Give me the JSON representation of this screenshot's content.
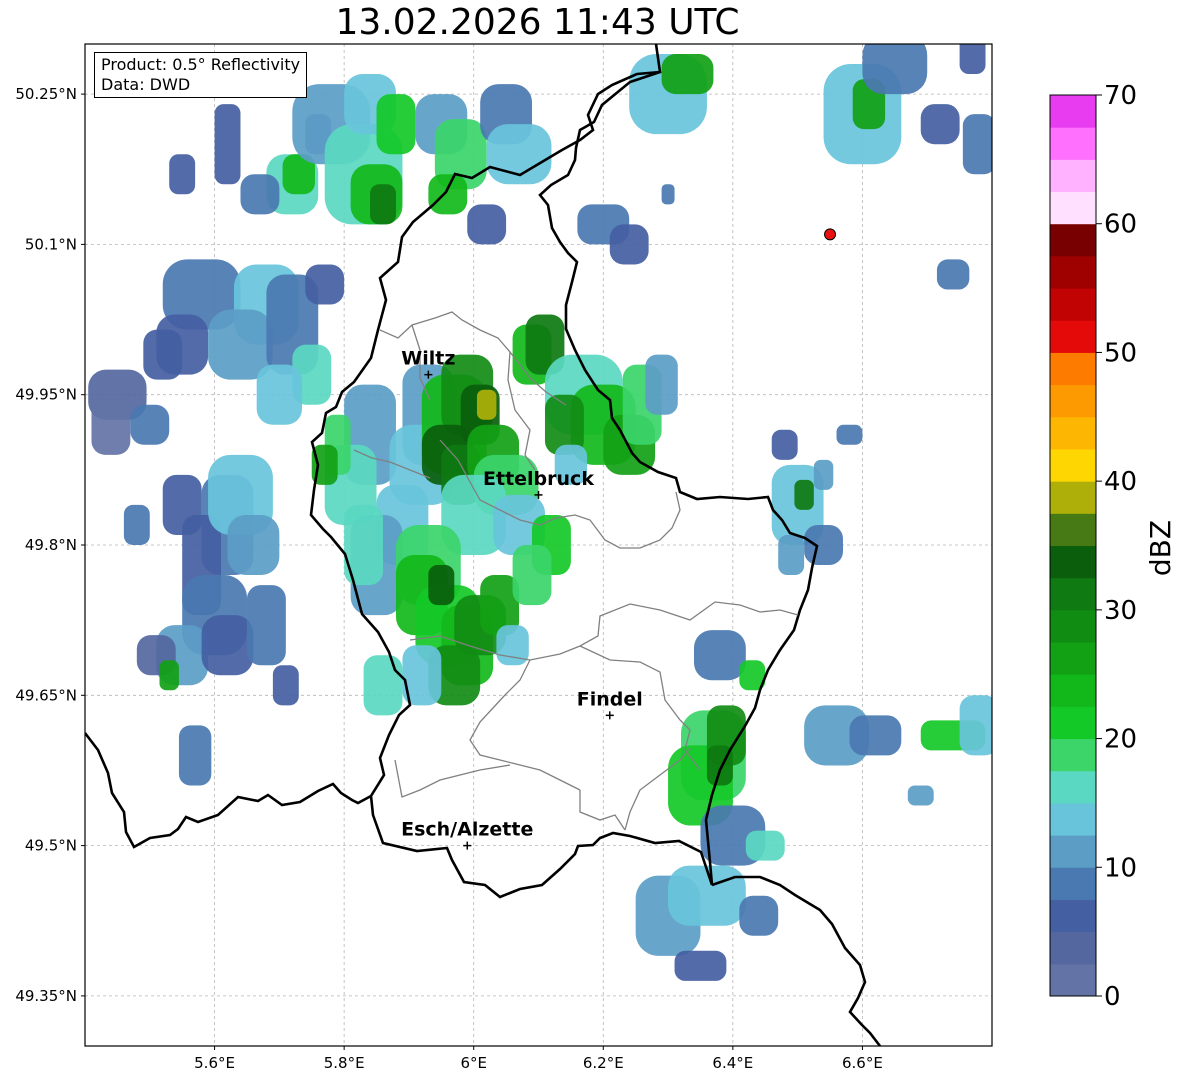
{
  "header": {
    "title": "13.02.2026 11:43 UTC"
  },
  "info_box": {
    "product": "Product: 0.5° Reflectivity",
    "data": "Data: DWD"
  },
  "axes": {
    "lon_range": [
      5.4,
      6.8
    ],
    "lat_range": [
      49.3,
      50.3
    ],
    "x_ticks": [
      "5.6°E",
      "5.8°E",
      "6°E",
      "6.2°E",
      "6.4°E",
      "6.6°E"
    ],
    "x_tick_values": [
      5.6,
      5.8,
      6.0,
      6.2,
      6.4,
      6.6
    ],
    "y_ticks": [
      "50.25°N",
      "50.1°N",
      "49.95°N",
      "49.8°N",
      "49.65°N",
      "49.5°N",
      "49.35°N"
    ],
    "y_tick_values": [
      50.25,
      50.1,
      49.95,
      49.8,
      49.65,
      49.5,
      49.35
    ],
    "grid": true
  },
  "cities": [
    {
      "name": "Wiltz",
      "lon": 5.93,
      "lat": 49.97
    },
    {
      "name": "Ettelbruck",
      "lon": 6.1,
      "lat": 49.85
    },
    {
      "name": "Findel",
      "lon": 6.21,
      "lat": 49.63
    },
    {
      "name": "Esch/Alzette",
      "lon": 5.99,
      "lat": 49.5
    }
  ],
  "radar_site": {
    "lon": 6.55,
    "lat": 50.11,
    "color": "#e81010"
  },
  "colorbar": {
    "label": "dBZ",
    "min": 0,
    "max": 70,
    "tick_labels": [
      "0",
      "10",
      "20",
      "30",
      "40",
      "50",
      "60",
      "70"
    ],
    "tick_values": [
      0,
      10,
      20,
      30,
      40,
      50,
      60,
      70
    ],
    "colors": [
      "#6373a5",
      "#54679f",
      "#4460a2",
      "#4a78b1",
      "#5b9dc5",
      "#68c4db",
      "#5ad8c1",
      "#3bd56a",
      "#13c927",
      "#12b81a",
      "#12a115",
      "#118c13",
      "#0e7a11",
      "#0a5e0c",
      "#477a14",
      "#aeb009",
      "#fed702",
      "#fdb702",
      "#fd9a01",
      "#fd7c00",
      "#e40a0a",
      "#c20303",
      "#9f0101",
      "#790000",
      "#ffe0ff",
      "#ffb2ff",
      "#ff70ff",
      "#e73cf0"
    ]
  },
  "echoes": [
    [
      5.45,
      49.95,
      0.045,
      0.025,
      1
    ],
    [
      5.44,
      49.92,
      0.03,
      0.03,
      0
    ],
    [
      5.52,
      49.99,
      0.03,
      0.025,
      2
    ],
    [
      5.58,
      50.05,
      0.06,
      0.035,
      3
    ],
    [
      5.55,
      50.0,
      0.04,
      0.03,
      2
    ],
    [
      5.68,
      50.04,
      0.05,
      0.04,
      5
    ],
    [
      5.64,
      50.0,
      0.05,
      0.035,
      4
    ],
    [
      5.72,
      50.02,
      0.04,
      0.05,
      3
    ],
    [
      5.75,
      49.97,
      0.03,
      0.03,
      6
    ],
    [
      5.7,
      49.95,
      0.035,
      0.03,
      5
    ],
    [
      5.77,
      50.06,
      0.03,
      0.02,
      2
    ],
    [
      5.5,
      49.92,
      0.03,
      0.02,
      3
    ],
    [
      5.72,
      50.16,
      0.04,
      0.03,
      6
    ],
    [
      5.73,
      50.17,
      0.025,
      0.02,
      9
    ],
    [
      5.67,
      50.15,
      0.03,
      0.02,
      3
    ],
    [
      5.62,
      50.2,
      0.02,
      0.04,
      2
    ],
    [
      5.76,
      50.21,
      0.02,
      0.02,
      3
    ],
    [
      5.55,
      50.17,
      0.02,
      0.02,
      2
    ],
    [
      5.78,
      50.22,
      0.06,
      0.04,
      4
    ],
    [
      5.83,
      50.17,
      0.06,
      0.05,
      6
    ],
    [
      5.85,
      50.15,
      0.04,
      0.03,
      9
    ],
    [
      5.86,
      50.14,
      0.02,
      0.02,
      12
    ],
    [
      5.84,
      50.24,
      0.04,
      0.03,
      5
    ],
    [
      5.95,
      50.22,
      0.04,
      0.03,
      4
    ],
    [
      5.98,
      50.19,
      0.04,
      0.035,
      7
    ],
    [
      5.96,
      50.15,
      0.03,
      0.02,
      9
    ],
    [
      6.05,
      50.23,
      0.04,
      0.03,
      3
    ],
    [
      6.07,
      50.19,
      0.05,
      0.03,
      5
    ],
    [
      6.02,
      50.12,
      0.03,
      0.02,
      2
    ],
    [
      6.2,
      50.12,
      0.04,
      0.02,
      3
    ],
    [
      5.88,
      50.22,
      0.03,
      0.03,
      8
    ],
    [
      5.84,
      49.91,
      0.04,
      0.05,
      4
    ],
    [
      5.81,
      49.86,
      0.04,
      0.04,
      6
    ],
    [
      5.79,
      49.9,
      0.02,
      0.03,
      7
    ],
    [
      5.77,
      49.88,
      0.02,
      0.02,
      10
    ],
    [
      5.93,
      49.93,
      0.04,
      0.05,
      4
    ],
    [
      5.92,
      49.88,
      0.05,
      0.04,
      5
    ],
    [
      5.97,
      49.92,
      0.05,
      0.05,
      9
    ],
    [
      5.99,
      49.95,
      0.04,
      0.04,
      11
    ],
    [
      6.01,
      49.93,
      0.03,
      0.03,
      13
    ],
    [
      6.02,
      49.94,
      0.015,
      0.015,
      15
    ],
    [
      5.96,
      49.89,
      0.04,
      0.03,
      13
    ],
    [
      5.98,
      49.87,
      0.03,
      0.03,
      12
    ],
    [
      6.03,
      49.89,
      0.04,
      0.03,
      10
    ],
    [
      6.05,
      49.86,
      0.05,
      0.03,
      7
    ],
    [
      6.0,
      49.83,
      0.05,
      0.04,
      6
    ],
    [
      6.07,
      49.82,
      0.04,
      0.03,
      5
    ],
    [
      6.12,
      49.8,
      0.03,
      0.03,
      8
    ],
    [
      6.09,
      49.99,
      0.03,
      0.03,
      9
    ],
    [
      6.11,
      50.0,
      0.03,
      0.03,
      12
    ],
    [
      6.17,
      49.95,
      0.06,
      0.04,
      6
    ],
    [
      6.2,
      49.92,
      0.05,
      0.04,
      9
    ],
    [
      6.24,
      49.9,
      0.04,
      0.03,
      10
    ],
    [
      6.26,
      49.94,
      0.03,
      0.04,
      7
    ],
    [
      6.14,
      49.92,
      0.03,
      0.03,
      11
    ],
    [
      6.29,
      49.96,
      0.025,
      0.03,
      4
    ],
    [
      6.15,
      49.88,
      0.025,
      0.02,
      5
    ],
    [
      5.89,
      49.82,
      0.04,
      0.04,
      5
    ],
    [
      5.85,
      49.78,
      0.04,
      0.05,
      4
    ],
    [
      5.93,
      49.78,
      0.05,
      0.04,
      7
    ],
    [
      5.92,
      49.75,
      0.04,
      0.04,
      9
    ],
    [
      5.96,
      49.72,
      0.05,
      0.04,
      8
    ],
    [
      5.99,
      49.7,
      0.04,
      0.04,
      9
    ],
    [
      6.01,
      49.72,
      0.04,
      0.03,
      11
    ],
    [
      6.04,
      49.74,
      0.03,
      0.03,
      10
    ],
    [
      6.09,
      49.77,
      0.03,
      0.03,
      7
    ],
    [
      5.97,
      49.67,
      0.04,
      0.03,
      11
    ],
    [
      5.92,
      49.67,
      0.03,
      0.03,
      5
    ],
    [
      5.86,
      49.66,
      0.03,
      0.03,
      6
    ],
    [
      5.83,
      49.8,
      0.03,
      0.04,
      6
    ],
    [
      6.06,
      49.7,
      0.025,
      0.02,
      5
    ],
    [
      5.95,
      49.76,
      0.02,
      0.02,
      13
    ],
    [
      5.62,
      49.82,
      0.04,
      0.05,
      3
    ],
    [
      5.58,
      49.78,
      0.03,
      0.05,
      2
    ],
    [
      5.64,
      49.85,
      0.05,
      0.04,
      5
    ],
    [
      5.66,
      49.8,
      0.04,
      0.03,
      4
    ],
    [
      5.55,
      49.84,
      0.03,
      0.03,
      2
    ],
    [
      5.48,
      49.82,
      0.02,
      0.02,
      3
    ],
    [
      5.6,
      49.73,
      0.05,
      0.04,
      3
    ],
    [
      5.55,
      49.69,
      0.04,
      0.03,
      4
    ],
    [
      5.62,
      49.7,
      0.04,
      0.03,
      2
    ],
    [
      5.68,
      49.72,
      0.03,
      0.04,
      3
    ],
    [
      5.51,
      49.69,
      0.03,
      0.02,
      1
    ],
    [
      5.53,
      49.67,
      0.015,
      0.015,
      10
    ],
    [
      5.71,
      49.66,
      0.02,
      0.02,
      2
    ],
    [
      5.57,
      49.59,
      0.025,
      0.03,
      3
    ],
    [
      6.37,
      49.59,
      0.05,
      0.045,
      7
    ],
    [
      6.35,
      49.56,
      0.05,
      0.04,
      8
    ],
    [
      6.39,
      49.61,
      0.03,
      0.03,
      11
    ],
    [
      6.38,
      49.58,
      0.02,
      0.02,
      12
    ],
    [
      6.4,
      49.51,
      0.05,
      0.03,
      3
    ],
    [
      6.45,
      49.5,
      0.03,
      0.015,
      6
    ],
    [
      6.38,
      49.69,
      0.04,
      0.025,
      3
    ],
    [
      6.43,
      49.67,
      0.02,
      0.015,
      8
    ],
    [
      6.56,
      49.61,
      0.05,
      0.03,
      4
    ],
    [
      6.62,
      49.61,
      0.04,
      0.02,
      3
    ],
    [
      6.74,
      49.61,
      0.05,
      0.015,
      8
    ],
    [
      6.78,
      49.62,
      0.03,
      0.03,
      5
    ],
    [
      6.3,
      49.43,
      0.05,
      0.04,
      4
    ],
    [
      6.36,
      49.45,
      0.06,
      0.03,
      5
    ],
    [
      6.35,
      49.38,
      0.04,
      0.015,
      2
    ],
    [
      6.44,
      49.43,
      0.03,
      0.02,
      3
    ],
    [
      6.69,
      49.55,
      0.02,
      0.01,
      4
    ],
    [
      6.5,
      49.84,
      0.04,
      0.04,
      5
    ],
    [
      6.51,
      49.85,
      0.015,
      0.015,
      12
    ],
    [
      6.54,
      49.87,
      0.015,
      0.015,
      4
    ],
    [
      6.54,
      49.8,
      0.03,
      0.02,
      3
    ],
    [
      6.49,
      49.79,
      0.02,
      0.02,
      4
    ],
    [
      6.48,
      49.9,
      0.02,
      0.015,
      2
    ],
    [
      6.58,
      49.91,
      0.02,
      0.01,
      3
    ],
    [
      6.3,
      50.25,
      0.06,
      0.04,
      5
    ],
    [
      6.33,
      50.27,
      0.04,
      0.02,
      10
    ],
    [
      6.6,
      50.23,
      0.06,
      0.05,
      5
    ],
    [
      6.61,
      50.24,
      0.025,
      0.025,
      10
    ],
    [
      6.65,
      50.28,
      0.05,
      0.03,
      3
    ],
    [
      6.72,
      50.22,
      0.03,
      0.02,
      2
    ],
    [
      6.78,
      50.2,
      0.025,
      0.03,
      3
    ],
    [
      6.77,
      50.29,
      0.02,
      0.02,
      2
    ],
    [
      6.74,
      50.07,
      0.025,
      0.015,
      3
    ],
    [
      6.24,
      50.1,
      0.03,
      0.02,
      2
    ],
    [
      6.3,
      50.15,
      0.01,
      0.01,
      3
    ]
  ]
}
